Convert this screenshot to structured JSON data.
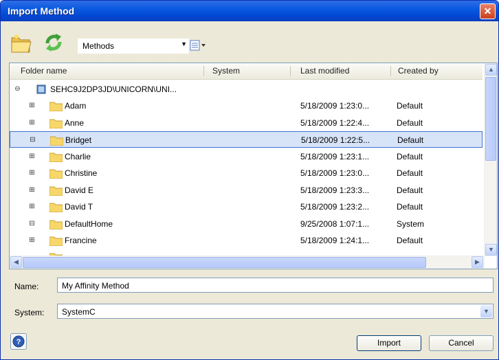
{
  "window": {
    "title": "Import Method"
  },
  "toolbar": {
    "location": "Methods"
  },
  "columns": {
    "folder": "Folder name",
    "system": "System",
    "modified": "Last modified",
    "created": "Created by"
  },
  "root": {
    "path": "SEHC9J2DP3JD\\UNICORN\\UNI..."
  },
  "rows": [
    {
      "name": "Adam",
      "modified": "5/18/2009 1:23:0...",
      "created": "Default",
      "expand": "+"
    },
    {
      "name": "Anne",
      "modified": "5/18/2009 1:22:4...",
      "created": "Default",
      "expand": "+"
    },
    {
      "name": "Bridget",
      "modified": "5/18/2009 1:22:5...",
      "created": "Default",
      "expand": "−",
      "selected": true
    },
    {
      "name": "Charlie",
      "modified": "5/18/2009 1:23:1...",
      "created": "Default",
      "expand": "+"
    },
    {
      "name": "Christine",
      "modified": "5/18/2009 1:23:0...",
      "created": "Default",
      "expand": "+"
    },
    {
      "name": "David E",
      "modified": "5/18/2009 1:23:3...",
      "created": "Default",
      "expand": "+"
    },
    {
      "name": "David T",
      "modified": "5/18/2009 1:23:2...",
      "created": "Default",
      "expand": "+"
    },
    {
      "name": "DefaultHome",
      "modified": "9/25/2008 1:07:1...",
      "created": "System",
      "expand": "−"
    },
    {
      "name": "Francine",
      "modified": "5/18/2009 1:24:1...",
      "created": "Default",
      "expand": "+"
    }
  ],
  "form": {
    "name_label": "Name:",
    "name_value": "My Affinity Method",
    "system_label": "System:",
    "system_value": "SystemC"
  },
  "buttons": {
    "import": "Import",
    "cancel": "Cancel"
  },
  "icons": {
    "close": "close-icon",
    "new_folder": "folder-open-icon",
    "refresh": "refresh-icon",
    "view": "view-list-icon",
    "help": "help-icon"
  },
  "colors": {
    "titlebar": "#0a5ae0",
    "selection": "#d7e4f8",
    "folder": "#f7d76a"
  }
}
